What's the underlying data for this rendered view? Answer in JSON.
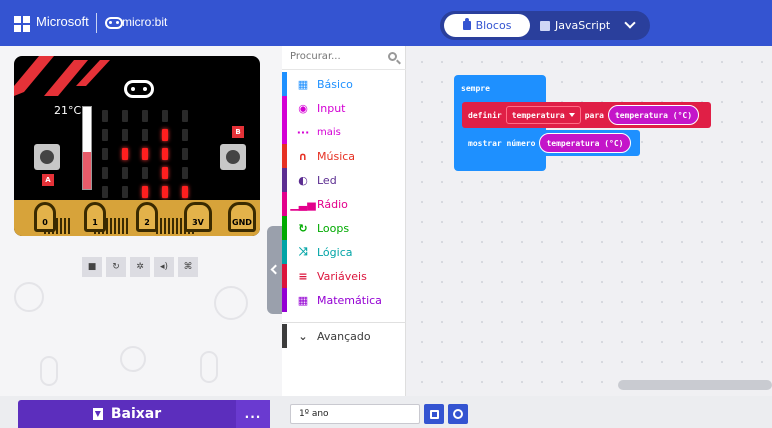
{
  "header": {
    "brand_ms": "Microsoft",
    "brand_product": "micro:bit",
    "tabs": [
      {
        "label": "Blocos",
        "active": true
      },
      {
        "label": "JavaScript",
        "active": false
      }
    ],
    "bar_color": "#3454d1"
  },
  "simulator": {
    "temperature_label": "21°C",
    "thermometer_fill_fraction": 0.45,
    "button_a": "A",
    "button_b": "B",
    "pins": [
      "0",
      "1",
      "2",
      "3V",
      "GND"
    ],
    "led_matrix": [
      [
        0,
        0,
        0,
        0,
        0
      ],
      [
        0,
        0,
        0,
        1,
        0
      ],
      [
        0,
        1,
        1,
        1,
        0
      ],
      [
        0,
        0,
        0,
        1,
        0
      ],
      [
        0,
        0,
        1,
        1,
        1
      ]
    ],
    "controls": [
      "stop-icon",
      "restart-icon",
      "slow-motion-icon",
      "mute-icon",
      "fullscreen-icon"
    ]
  },
  "toolbox": {
    "search_placeholder": "Procurar...",
    "categories": [
      {
        "label": "Básico",
        "color": "#1e90ff",
        "icon": "grid-icon"
      },
      {
        "label": "Input",
        "color": "#d400d4",
        "icon": "input-icon"
      },
      {
        "label": "mais",
        "color": "#d400d4",
        "icon": "more-icon"
      },
      {
        "label": "Música",
        "color": "#e63022",
        "icon": "headphones-icon"
      },
      {
        "label": "Led",
        "color": "#5c2d91",
        "icon": "toggle-icon"
      },
      {
        "label": "Rádio",
        "color": "#e3008c",
        "icon": "signal-icon"
      },
      {
        "label": "Loops",
        "color": "#00aa00",
        "icon": "loop-icon"
      },
      {
        "label": "Lógica",
        "color": "#00a4a6",
        "icon": "shuffle-icon"
      },
      {
        "label": "Variáveis",
        "color": "#dc143c",
        "icon": "lines-icon"
      },
      {
        "label": "Matemática",
        "color": "#9400d3",
        "icon": "calculator-icon"
      },
      {
        "label": "Avançado",
        "color": "#3c3c3c",
        "icon": "chevron-down-icon"
      }
    ]
  },
  "workspace": {
    "forever_label": "sempre",
    "set_keyword": "definir",
    "set_variable": "temperatura",
    "set_to": "para",
    "set_value": "temperatura (°C)",
    "show_keyword": "mostrar número",
    "show_value": "temperatura (°C)"
  },
  "footer": {
    "download_label": "Baixar",
    "more_label": "...",
    "project_name": "1º ano"
  }
}
